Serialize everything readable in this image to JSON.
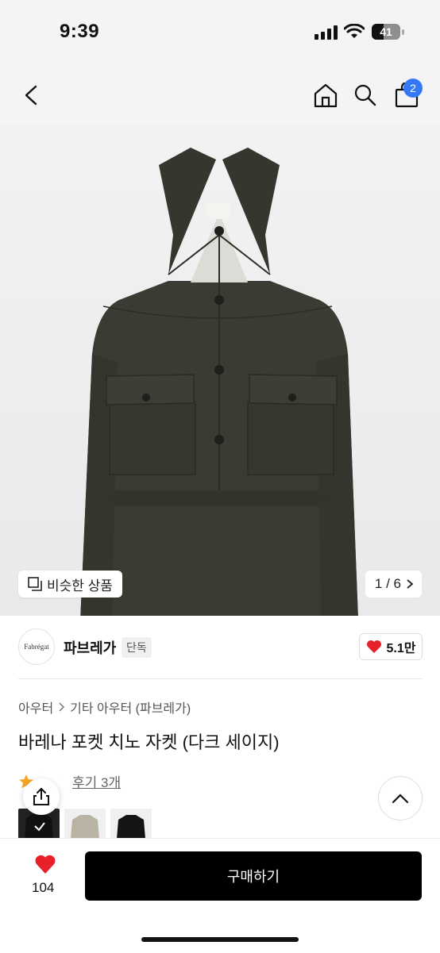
{
  "status_bar": {
    "time": "9:39",
    "battery": "41"
  },
  "nav": {
    "back_icon": "chevron-left-icon",
    "cart_count": "2"
  },
  "gallery": {
    "similar_label": "비슷한 상품",
    "counter": "1 / 6"
  },
  "brand": {
    "logo_text": "Fabrégat",
    "name": "파브레가",
    "badge": "단독",
    "likes": "5.1만"
  },
  "breadcrumb": {
    "items": [
      "아우터",
      "기타 아우터 (파브레가)"
    ]
  },
  "product": {
    "title": "바레나 포켓 치노 자켓 (다크 세이지)",
    "review_label": "후기 3개"
  },
  "bottom_bar": {
    "wish_count": "104",
    "buy_label": "구매하기"
  },
  "colors": {
    "accent_blue": "#3478f6",
    "heart_red": "#e8202a",
    "jacket": "#3a3b32"
  }
}
